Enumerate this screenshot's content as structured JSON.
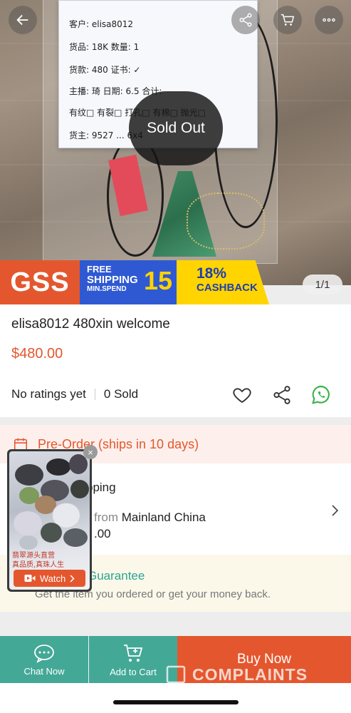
{
  "product_image": {
    "sold_out_label": "Sold Out",
    "counter": "1/1",
    "card_lines": [
      "客户: elisa8012",
      "货品: 18K   数量: 1",
      "货款: 480   证书: ✓",
      "主播: 琦   日期: 6.5   合计:",
      "有纹□ 有裂□ 打孔□ 有棉□ 抛光□",
      "货主: 9527 ... 6x4"
    ]
  },
  "top_bar": {
    "back_icon": "arrow-left-icon",
    "share_icon": "share-icon",
    "cart_icon": "cart-icon",
    "more_icon": "more-icon"
  },
  "promo_banner": {
    "brand": "GSS",
    "free": "FREE",
    "shipping": "SHIPPING",
    "min_spend": "MIN.SPEND",
    "amount": "15",
    "cashback_percent": "18%",
    "cashback": "CASHBACK"
  },
  "product": {
    "title": "elisa8012 480xin welcome",
    "price": "$480.00",
    "ratings": "No ratings yet",
    "sold": "0 Sold"
  },
  "preorder": {
    "label": "Pre-Order (ships in 10 days)"
  },
  "shipping": {
    "title": "pping",
    "from_prefix": "from",
    "from_place": "Mainland China",
    "fee": ".00"
  },
  "guarantee": {
    "title": "Guarantee",
    "description": "Get the item you ordered or get your money back."
  },
  "video": {
    "watch_label": "Watch",
    "close_label": "×",
    "caption_line1": "翡翠源头直营",
    "caption_line2": "真品质,真珠人生"
  },
  "bottom_bar": {
    "chat_label": "Chat Now",
    "cart_label": "Add to Cart",
    "buy_label": "Buy Now",
    "watermark": "COMPLAINTS"
  },
  "colors": {
    "accent": "#e4572e",
    "teal": "#44a897",
    "banner_blue": "#2f59d3",
    "banner_yellow": "#ffd400"
  }
}
